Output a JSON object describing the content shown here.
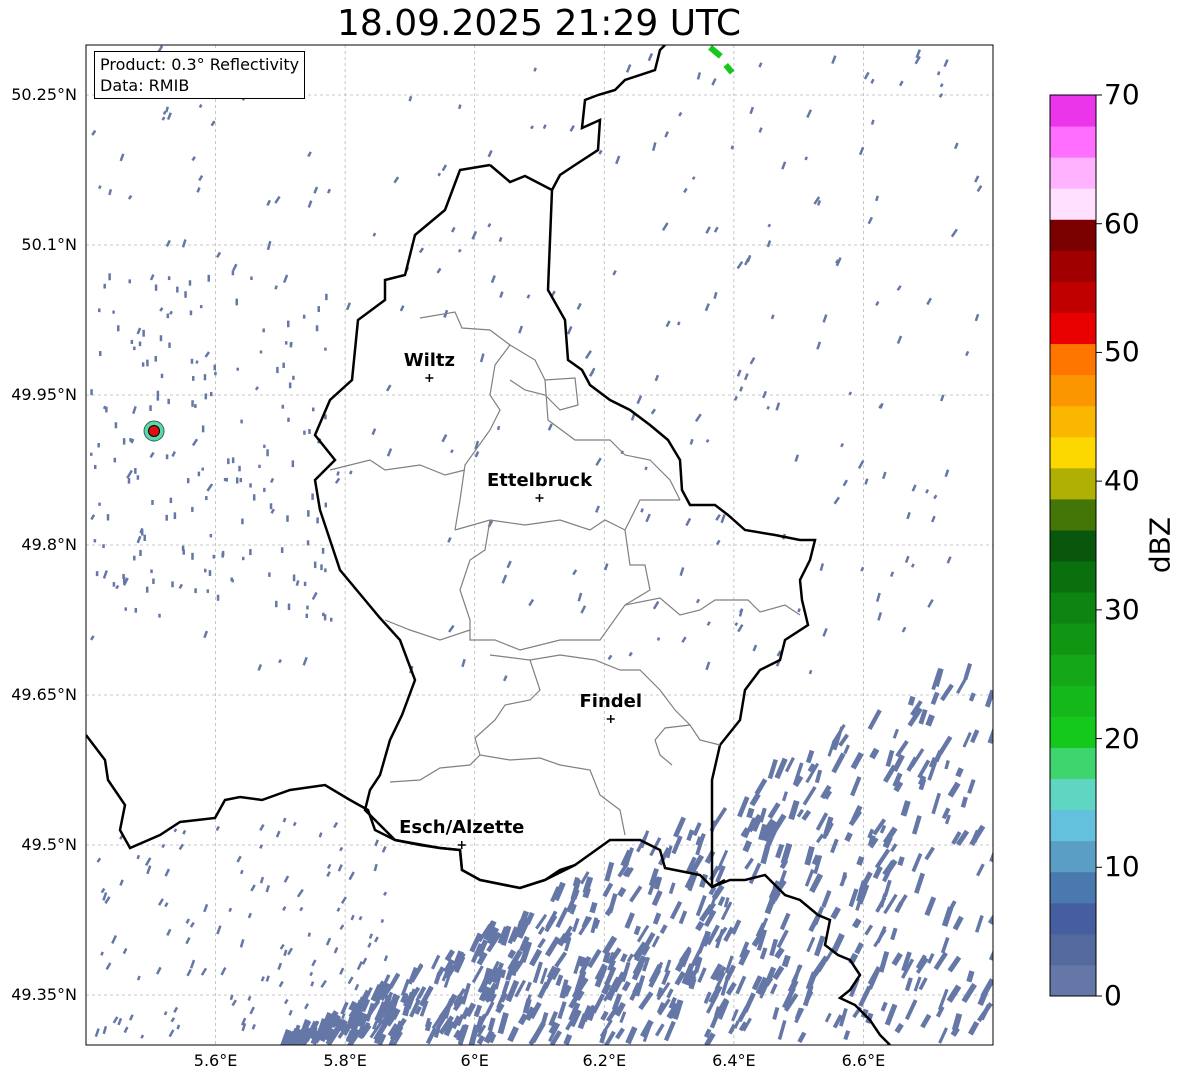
{
  "title": "18.09.2025 21:29 UTC",
  "info": {
    "product": "Product: 0.3° Reflectivity",
    "source": "Data: RMIB"
  },
  "map": {
    "lon_range": [
      5.4,
      6.8
    ],
    "lat_range": [
      49.3,
      50.3
    ],
    "lat_ticks": [
      {
        "value": 50.25,
        "label": "50.25°N"
      },
      {
        "value": 50.1,
        "label": "50.1°N"
      },
      {
        "value": 49.95,
        "label": "49.95°N"
      },
      {
        "value": 49.8,
        "label": "49.8°N"
      },
      {
        "value": 49.65,
        "label": "49.65°N"
      },
      {
        "value": 49.5,
        "label": "49.5°N"
      },
      {
        "value": 49.35,
        "label": "49.35°N"
      }
    ],
    "lon_ticks": [
      {
        "value": 5.6,
        "label": "5.6°E"
      },
      {
        "value": 5.8,
        "label": "5.8°E"
      },
      {
        "value": 6.0,
        "label": "6°E"
      },
      {
        "value": 6.2,
        "label": "6.2°E"
      },
      {
        "value": 6.4,
        "label": "6.4°E"
      },
      {
        "value": 6.6,
        "label": "6.6°E"
      }
    ],
    "grid": true,
    "cities": [
      {
        "name": "Wiltz",
        "lon": 5.93,
        "lat": 49.967
      },
      {
        "name": "Ettelbruck",
        "lon": 6.1,
        "lat": 49.847
      },
      {
        "name": "Findel",
        "lon": 6.21,
        "lat": 49.626
      },
      {
        "name": "Esch/Alzette",
        "lon": 5.98,
        "lat": 49.5
      }
    ],
    "radar_site": {
      "lon": 5.505,
      "lat": 49.914
    },
    "colors": {
      "national_border": "#000000",
      "canton_border": "#808080",
      "light_echo": "#6577a6",
      "radar_site": "#dd1111"
    }
  },
  "colorbar": {
    "label": "dBZ",
    "min": 0,
    "max": 70,
    "ticks": [
      0,
      10,
      20,
      30,
      40,
      50,
      60,
      70
    ],
    "colors": [
      "#6577a6",
      "#54699e",
      "#445e9f",
      "#4a79b0",
      "#5a9ec5",
      "#63c1dd",
      "#5ed6c2",
      "#3ed46e",
      "#14c81c",
      "#14b81a",
      "#14a818",
      "#119614",
      "#0f8511",
      "#0a700d",
      "#09570d",
      "#437607",
      "#b0b004",
      "#fdd700",
      "#fbb600",
      "#fc9600",
      "#fe7600",
      "#e80000",
      "#c00000",
      "#a00000",
      "#7b0000",
      "#ffe0ff",
      "#ffb3ff",
      "#ff6eff",
      "#ea35ea"
    ]
  }
}
